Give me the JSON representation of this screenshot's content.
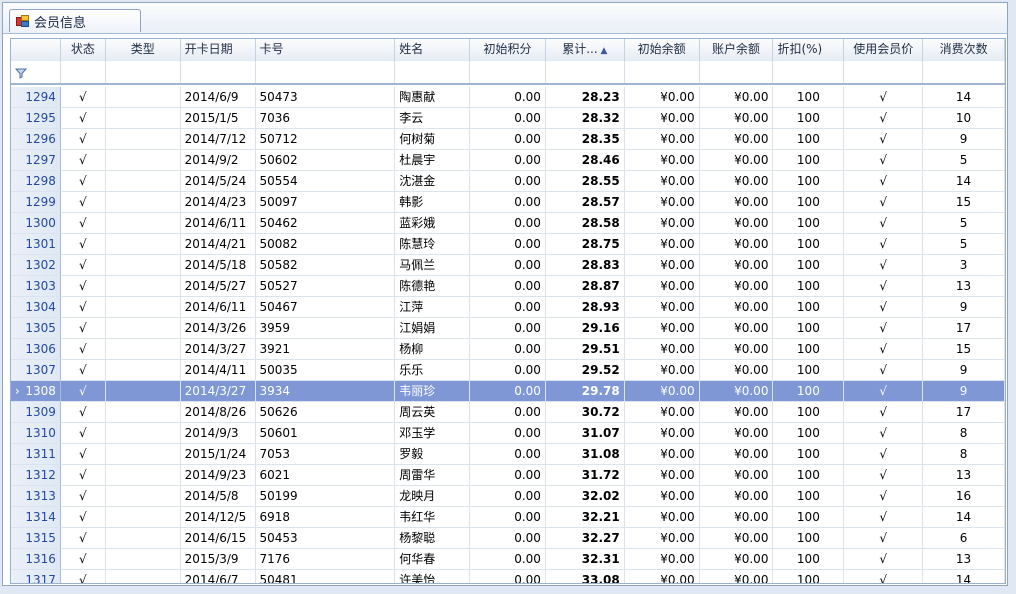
{
  "window": {
    "tab_title": "会员信息",
    "tab_icon": "member-info-icon"
  },
  "grid": {
    "columns": [
      "",
      "状态",
      "类型",
      "开卡日期",
      "卡号",
      "姓名",
      "初始积分",
      "累计...",
      "初始余额",
      "账户余额",
      "折扣(%)",
      "使用会员价",
      "消费次数"
    ],
    "sort_indicator": "▲",
    "filter_icon": "funnel-icon",
    "selected_row_marker": "›",
    "colors": {
      "selected_row": "#7f97d4",
      "row_header_text": "#2348a0"
    },
    "rows": [
      {
        "id": "1294",
        "status": "√",
        "type": "",
        "date": "2014/6/9",
        "card": "50473",
        "name": "陶惠献",
        "init_points": "0.00",
        "total": "28.23",
        "init_bal": "¥0.00",
        "acct_bal": "¥0.00",
        "discount": "100",
        "member_price": "√",
        "count": "14"
      },
      {
        "id": "1295",
        "status": "√",
        "type": "",
        "date": "2015/1/5",
        "card": "7036",
        "name": "李云",
        "init_points": "0.00",
        "total": "28.32",
        "init_bal": "¥0.00",
        "acct_bal": "¥0.00",
        "discount": "100",
        "member_price": "√",
        "count": "10"
      },
      {
        "id": "1296",
        "status": "√",
        "type": "",
        "date": "2014/7/12",
        "card": "50712",
        "name": "何树菊",
        "init_points": "0.00",
        "total": "28.35",
        "init_bal": "¥0.00",
        "acct_bal": "¥0.00",
        "discount": "100",
        "member_price": "√",
        "count": "9"
      },
      {
        "id": "1297",
        "status": "√",
        "type": "",
        "date": "2014/9/2",
        "card": "50602",
        "name": "杜晨宇",
        "init_points": "0.00",
        "total": "28.46",
        "init_bal": "¥0.00",
        "acct_bal": "¥0.00",
        "discount": "100",
        "member_price": "√",
        "count": "5"
      },
      {
        "id": "1298",
        "status": "√",
        "type": "",
        "date": "2014/5/24",
        "card": "50554",
        "name": "沈湛金",
        "init_points": "0.00",
        "total": "28.55",
        "init_bal": "¥0.00",
        "acct_bal": "¥0.00",
        "discount": "100",
        "member_price": "√",
        "count": "14"
      },
      {
        "id": "1299",
        "status": "√",
        "type": "",
        "date": "2014/4/23",
        "card": "50097",
        "name": "韩影",
        "init_points": "0.00",
        "total": "28.57",
        "init_bal": "¥0.00",
        "acct_bal": "¥0.00",
        "discount": "100",
        "member_price": "√",
        "count": "15"
      },
      {
        "id": "1300",
        "status": "√",
        "type": "",
        "date": "2014/6/11",
        "card": "50462",
        "name": "蓝彩娥",
        "init_points": "0.00",
        "total": "28.58",
        "init_bal": "¥0.00",
        "acct_bal": "¥0.00",
        "discount": "100",
        "member_price": "√",
        "count": "5"
      },
      {
        "id": "1301",
        "status": "√",
        "type": "",
        "date": "2014/4/21",
        "card": "50082",
        "name": "陈慧玲",
        "init_points": "0.00",
        "total": "28.75",
        "init_bal": "¥0.00",
        "acct_bal": "¥0.00",
        "discount": "100",
        "member_price": "√",
        "count": "5"
      },
      {
        "id": "1302",
        "status": "√",
        "type": "",
        "date": "2014/5/18",
        "card": "50582",
        "name": "马佩兰",
        "init_points": "0.00",
        "total": "28.83",
        "init_bal": "¥0.00",
        "acct_bal": "¥0.00",
        "discount": "100",
        "member_price": "√",
        "count": "3"
      },
      {
        "id": "1303",
        "status": "√",
        "type": "",
        "date": "2014/5/27",
        "card": "50527",
        "name": "陈德艳",
        "init_points": "0.00",
        "total": "28.87",
        "init_bal": "¥0.00",
        "acct_bal": "¥0.00",
        "discount": "100",
        "member_price": "√",
        "count": "13"
      },
      {
        "id": "1304",
        "status": "√",
        "type": "",
        "date": "2014/6/11",
        "card": "50467",
        "name": "江萍",
        "init_points": "0.00",
        "total": "28.93",
        "init_bal": "¥0.00",
        "acct_bal": "¥0.00",
        "discount": "100",
        "member_price": "√",
        "count": "9"
      },
      {
        "id": "1305",
        "status": "√",
        "type": "",
        "date": "2014/3/26",
        "card": "3959",
        "name": "江娟娟",
        "init_points": "0.00",
        "total": "29.16",
        "init_bal": "¥0.00",
        "acct_bal": "¥0.00",
        "discount": "100",
        "member_price": "√",
        "count": "17"
      },
      {
        "id": "1306",
        "status": "√",
        "type": "",
        "date": "2014/3/27",
        "card": "3921",
        "name": "杨柳",
        "init_points": "0.00",
        "total": "29.51",
        "init_bal": "¥0.00",
        "acct_bal": "¥0.00",
        "discount": "100",
        "member_price": "√",
        "count": "15"
      },
      {
        "id": "1307",
        "status": "√",
        "type": "",
        "date": "2014/4/11",
        "card": "50035",
        "name": "乐乐",
        "init_points": "0.00",
        "total": "29.52",
        "init_bal": "¥0.00",
        "acct_bal": "¥0.00",
        "discount": "100",
        "member_price": "√",
        "count": "9"
      },
      {
        "id": "1308",
        "status": "√",
        "type": "",
        "date": "2014/3/27",
        "card": "3934",
        "name": "韦丽珍",
        "init_points": "0.00",
        "total": "29.78",
        "init_bal": "¥0.00",
        "acct_bal": "¥0.00",
        "discount": "100",
        "member_price": "√",
        "count": "9",
        "selected": true
      },
      {
        "id": "1309",
        "status": "√",
        "type": "",
        "date": "2014/8/26",
        "card": "50626",
        "name": "周云英",
        "init_points": "0.00",
        "total": "30.72",
        "init_bal": "¥0.00",
        "acct_bal": "¥0.00",
        "discount": "100",
        "member_price": "√",
        "count": "17"
      },
      {
        "id": "1310",
        "status": "√",
        "type": "",
        "date": "2014/9/3",
        "card": "50601",
        "name": "邓玉学",
        "init_points": "0.00",
        "total": "31.07",
        "init_bal": "¥0.00",
        "acct_bal": "¥0.00",
        "discount": "100",
        "member_price": "√",
        "count": "8"
      },
      {
        "id": "1311",
        "status": "√",
        "type": "",
        "date": "2015/1/24",
        "card": "7053",
        "name": "罗毅",
        "init_points": "0.00",
        "total": "31.08",
        "init_bal": "¥0.00",
        "acct_bal": "¥0.00",
        "discount": "100",
        "member_price": "√",
        "count": "8"
      },
      {
        "id": "1312",
        "status": "√",
        "type": "",
        "date": "2014/9/23",
        "card": "6021",
        "name": "周雷华",
        "init_points": "0.00",
        "total": "31.72",
        "init_bal": "¥0.00",
        "acct_bal": "¥0.00",
        "discount": "100",
        "member_price": "√",
        "count": "13"
      },
      {
        "id": "1313",
        "status": "√",
        "type": "",
        "date": "2014/5/8",
        "card": "50199",
        "name": "龙映月",
        "init_points": "0.00",
        "total": "32.02",
        "init_bal": "¥0.00",
        "acct_bal": "¥0.00",
        "discount": "100",
        "member_price": "√",
        "count": "16"
      },
      {
        "id": "1314",
        "status": "√",
        "type": "",
        "date": "2014/12/5",
        "card": "6918",
        "name": "韦红华",
        "init_points": "0.00",
        "total": "32.21",
        "init_bal": "¥0.00",
        "acct_bal": "¥0.00",
        "discount": "100",
        "member_price": "√",
        "count": "14"
      },
      {
        "id": "1315",
        "status": "√",
        "type": "",
        "date": "2014/6/15",
        "card": "50453",
        "name": "杨黎聪",
        "init_points": "0.00",
        "total": "32.27",
        "init_bal": "¥0.00",
        "acct_bal": "¥0.00",
        "discount": "100",
        "member_price": "√",
        "count": "6"
      },
      {
        "id": "1316",
        "status": "√",
        "type": "",
        "date": "2015/3/9",
        "card": "7176",
        "name": "何华春",
        "init_points": "0.00",
        "total": "32.31",
        "init_bal": "¥0.00",
        "acct_bal": "¥0.00",
        "discount": "100",
        "member_price": "√",
        "count": "13"
      },
      {
        "id": "1317",
        "status": "√",
        "type": "",
        "date": "2014/6/7",
        "card": "50481",
        "name": "许美怡",
        "init_points": "0.00",
        "total": "33.08",
        "init_bal": "¥0.00",
        "acct_bal": "¥0.00",
        "discount": "100",
        "member_price": "√",
        "count": "14"
      }
    ]
  }
}
